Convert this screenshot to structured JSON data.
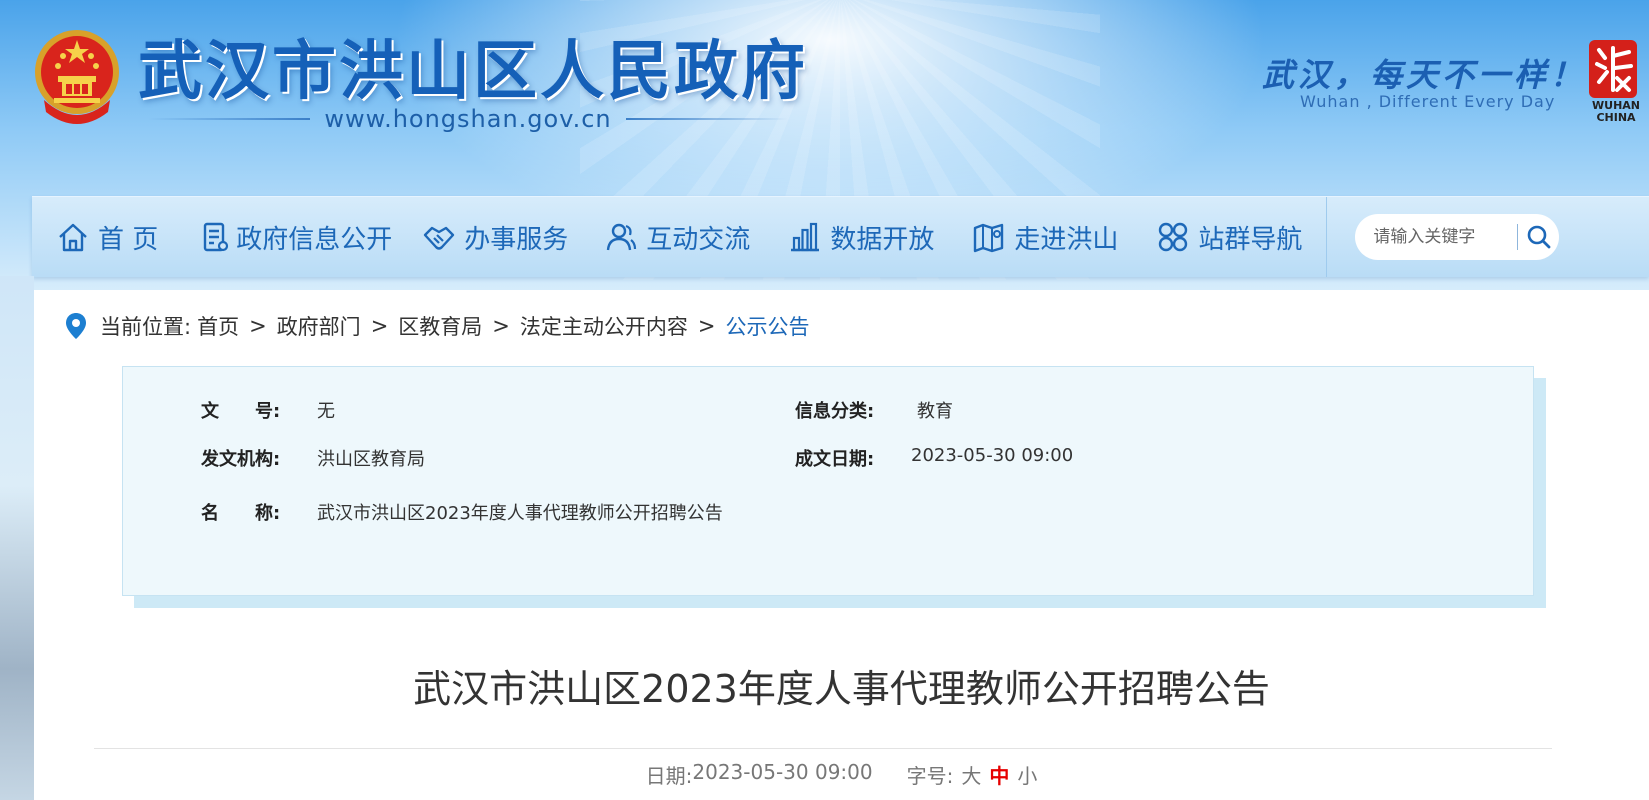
{
  "header": {
    "site_title": "武汉市洪山区人民政府",
    "site_url": "www.hongshan.gov.cn",
    "slogan": "武汉，每天不一样！",
    "slogan_en": "Wuhan , Different Every Day",
    "logo_text": "WUHAN CHINA"
  },
  "nav": {
    "items": [
      {
        "label": "首 页",
        "icon": "home-icon"
      },
      {
        "label": "政府信息公开",
        "icon": "document-icon"
      },
      {
        "label": "办事服务",
        "icon": "handshake-icon"
      },
      {
        "label": "互动交流",
        "icon": "people-icon"
      },
      {
        "label": "数据开放",
        "icon": "bar-chart-icon"
      },
      {
        "label": "走进洪山",
        "icon": "map-icon"
      },
      {
        "label": "站群导航",
        "icon": "grid-icon"
      }
    ],
    "search_placeholder": "请输入关键字"
  },
  "breadcrumb": {
    "prefix": "当前位置:",
    "items": [
      "首页",
      "政府部门",
      "区教育局",
      "法定主动公开内容",
      "公示公告"
    ],
    "separator": ">"
  },
  "info": {
    "doc_no_label": "文　　号:",
    "doc_no_value": "无",
    "category_label": "信息分类:",
    "category_value": "教育",
    "issuer_label": "发文机构:",
    "issuer_value": "洪山区教育局",
    "date_label": "成文日期:",
    "date_value": "2023-05-30 09:00",
    "name_label": "名　　称:",
    "name_value": "武汉市洪山区2023年度人事代理教师公开招聘公告"
  },
  "article": {
    "title": "武汉市洪山区2023年度人事代理教师公开招聘公告",
    "date_label": "日期:",
    "date_value": "2023-05-30 09:00",
    "font_size_label": "字号:",
    "font_sizes": [
      "大",
      "中",
      "小"
    ],
    "active_font_size": "中"
  },
  "colors": {
    "brand_blue": "#1d68b8",
    "active_red": "#e60000",
    "info_bg": "#eef8fc"
  }
}
